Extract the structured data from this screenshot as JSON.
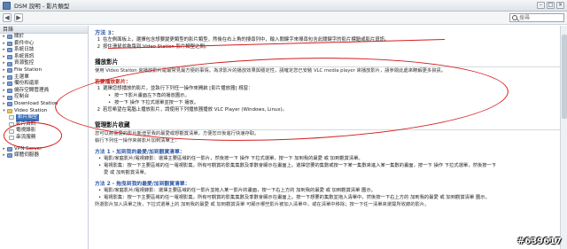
{
  "window": {
    "title": "DSM 說明 - 影片類型"
  },
  "toolbar": {
    "back": "◀",
    "forward": "▶",
    "search_placeholder": "搜尋"
  },
  "sidebar": {
    "header": "目錄",
    "items": [
      {
        "label": "關於",
        "level": 0,
        "icon": "book-icon",
        "gap": false
      },
      {
        "label": "套件中心",
        "level": 0,
        "icon": "book-icon",
        "gap": false
      },
      {
        "label": "系統日誌",
        "level": 0,
        "icon": "book-icon",
        "gap": false
      },
      {
        "label": "系統資訊",
        "level": 0,
        "icon": "book-icon",
        "gap": false
      },
      {
        "label": "資源監控",
        "level": 0,
        "icon": "book-icon",
        "gap": false
      },
      {
        "label": "File Station",
        "level": 0,
        "icon": "book-icon",
        "gap": false
      },
      {
        "label": "主選單",
        "level": 0,
        "icon": "book-icon",
        "gap": false
      },
      {
        "label": "備份和還原",
        "level": 0,
        "icon": "book-icon",
        "gap": false
      },
      {
        "label": "儲存空間管理員",
        "level": 0,
        "icon": "book-icon",
        "gap": false
      },
      {
        "label": "控制台",
        "level": 0,
        "icon": "book-icon",
        "gap": false
      },
      {
        "label": "Download Station",
        "level": 0,
        "icon": "book-icon",
        "gap": false
      },
      {
        "label": "Video Station",
        "level": 0,
        "icon": "folder-icon",
        "gap": false
      },
      {
        "label": "影片類型",
        "level": 1,
        "icon": "page-icon",
        "gap": false,
        "selected": true
      },
      {
        "label": "影片資訊",
        "level": 1,
        "icon": "page-icon",
        "gap": false
      },
      {
        "label": "電視錄影",
        "level": 1,
        "icon": "page-icon",
        "gap": false
      },
      {
        "label": "串流服務",
        "level": 1,
        "icon": "page-icon",
        "gap": false
      },
      {
        "label": "VPN Server",
        "level": 0,
        "icon": "book-icon",
        "gap": true
      },
      {
        "label": "媒體伺服器",
        "level": 0,
        "icon": "book-icon",
        "gap": false
      }
    ]
  },
  "content": {
    "method3_title": "方法 3：",
    "method3_steps": [
      "在左側面板上，選擇包含想要變更類型的影片類型，然後在右上角的搜尋列中，輸入關鍵字來搜尋包含此關鍵字的影片標題或影片資訊。",
      "按住滑鼠並拖曳到 Video Station 影片類型之間。"
    ],
    "playback": {
      "title": "播放影片",
      "intro": "使用 Video Station 來播放影片是最常見最方便的事情。為求影片的播放效果與穩定性，請確定您已安裝 VLC media player 來播放影片，請參閱此處來瞭解更多資訊。",
      "howto_title": "若要播放影片：",
      "steps": [
        "選擇您想播放的影片，並執行下列任一操作來開啟 [影片播放器] 視窗：",
        "若您希望在電腦上播放影片，請使用下列播放器播放 VLC Player (Windows, Linux)。"
      ],
      "sub_bullets": [
        "按一下影片畫面左下角的播放圖示。",
        "按一下 操作 下拉式選單並按一下 播放。"
      ]
    },
    "favorites": {
      "title": "管理影片收藏",
      "intro1": "您可以將喜愛的影片新增至我的最愛或想觀賞清單，方便您日後進行快速存取。",
      "intro2": "執行下列任一操作來將影片加到清單上：",
      "method1_title": "方法 1 - 加到我的最愛/加到觀賞清單：",
      "method1_bullets": [
        "電影/家庭影片/電視錄影：選擇主要區域的任一影片，然後按一下 操作 下拉式選單，按一下 加到我的最愛 或 加到觀賞清單。",
        "電視影集：按一下主要區域的任一電視影集，所有可觀賞的影集集數及季數會顯示在畫面上。選擇您要的集數或按一下某一集數來進入某一集數的畫面，按一下 操作 下拉式選單，然後按一下",
        "愛 或 加到觀賞清單。"
      ],
      "method2_title": "方法 2 - 拖曳到我的最愛/加到觀賞清單：",
      "method2_bullets": [
        "電影/家庭影片/電視錄影：選擇主要區域的任一影片並拖入某一影片的畫面，按一下右上方的 加到我的最愛 或 加到觀賞清單 圖示。",
        "電視影集：按一下主要區域的任一電視影集，所有可觀賞的影集集數及季數會顯示在畫面上。按一下想要的集數並拖入清單中，然後按一下右上方的 加到我的最愛 或 加到觀賞清單 圖示。"
      ],
      "footer": "所選影片加入清單之後，下拉式選單上的 加到我的最愛 或 加到觀賞清單 可顯示哪些影片被加入清單中，或在清單中移除；按一下任一清單來瀏覽所收錄的影片。"
    }
  },
  "watermark": "#639617",
  "colors": {
    "annotation": "#d21d1d",
    "accent": "#2f5aa8",
    "selected": "#3d6fbf"
  }
}
